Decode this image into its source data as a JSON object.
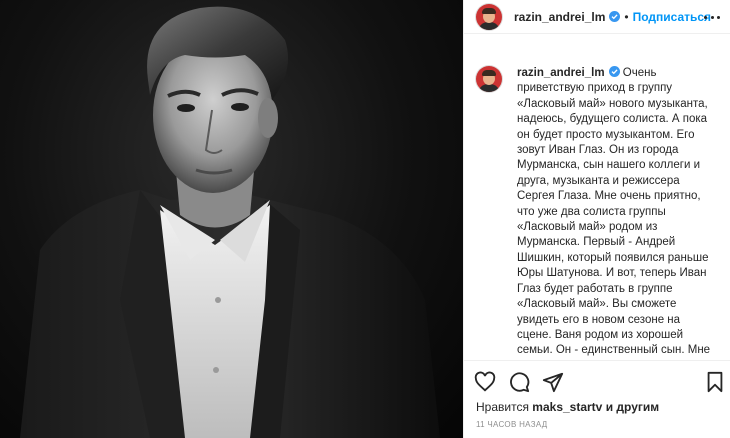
{
  "post": {
    "username": "razin_andrei_lm",
    "separator": "•",
    "follow_label": "Подписаться",
    "caption_text": "Очень приветствую приход в группу «Ласковый май» нового музыканта, надеюсь, будущего солиста. А пока он будет просто музыкантом. Его зовут Иван Глаз. Он из города Мурманска, сын нашего коллеги и друга, музыканта и режиссера Сергея Глаза. Мне очень приятно, что уже два солиста группы «Ласковый май» родом из Мурманска. Первый - Андрей Шишкин, который появился раньше Юры Шатунова. И вот, теперь Иван Глаз будет работать в группе «Ласковый май». Вы сможете увидеть его в новом сезоне на сцене. Ваня родом из хорошей семьи. Он - единственный сын. Мне очень приятно, что Ваня принял",
    "likes_prefix": "Нравится",
    "likes_user": "maks_startv",
    "likes_suffix": "и другим",
    "timestamp": "11 часов назад"
  },
  "icons": {
    "like": "heart-icon",
    "comment": "comment-icon",
    "share": "share-icon",
    "save": "bookmark-icon",
    "verified": "verified-badge-icon",
    "more": "more-options-icon"
  },
  "colors": {
    "follow": "#0095f6",
    "verified": "#3897f0",
    "text": "#262626",
    "muted": "#8e8e8e"
  }
}
